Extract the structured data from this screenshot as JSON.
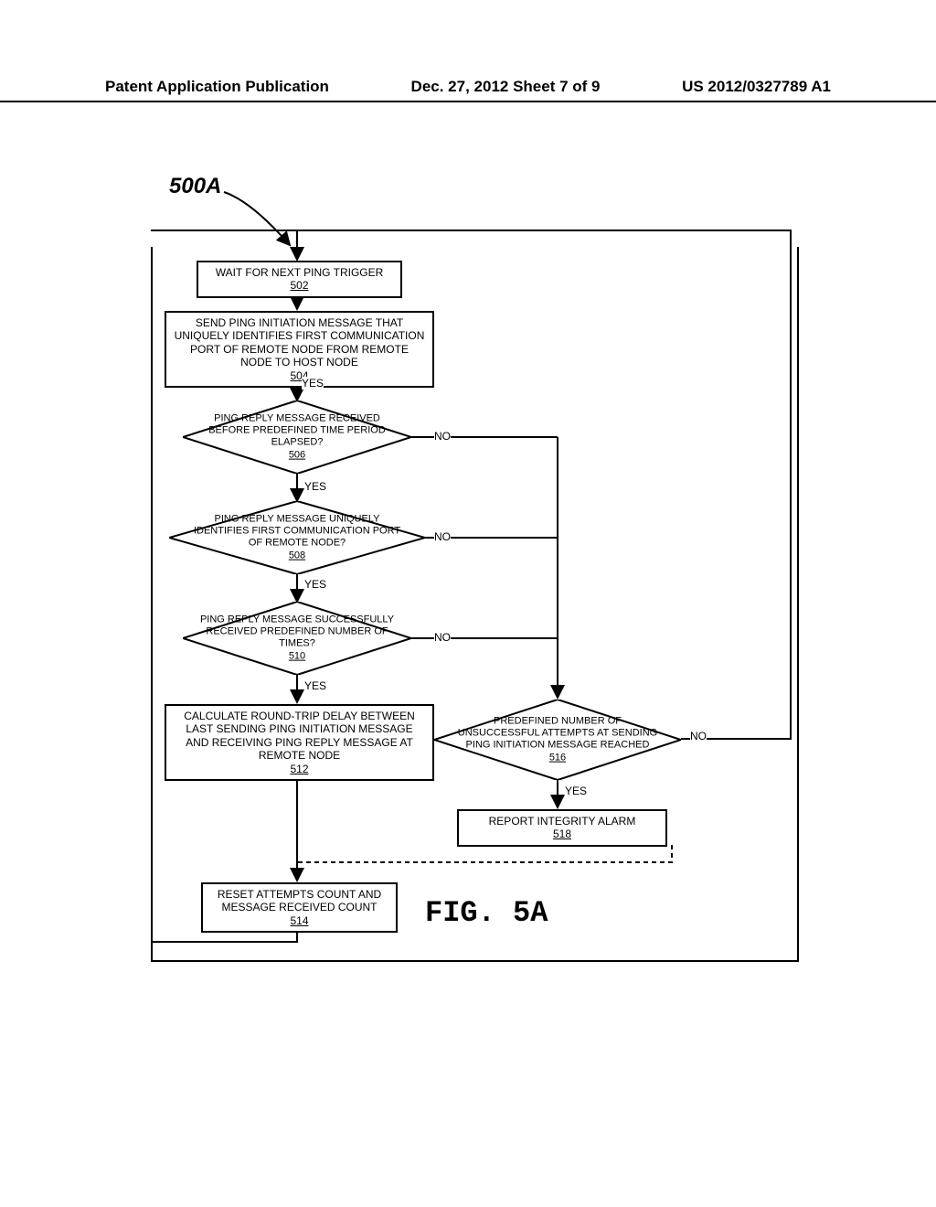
{
  "header": {
    "left": "Patent Application Publication",
    "center": "Dec. 27, 2012  Sheet 7 of 9",
    "right": "US 2012/0327789 A1"
  },
  "refLabel": "500A",
  "boxes": {
    "b502": {
      "text": "WAIT FOR NEXT PING TRIGGER",
      "ref": "502"
    },
    "b504": {
      "text": "SEND PING INITIATION MESSAGE THAT UNIQUELY IDENTIFIES FIRST COMMUNICATION PORT OF REMOTE NODE FROM REMOTE NODE TO HOST NODE",
      "ref": "504"
    },
    "b506": {
      "text": "PING REPLY MESSAGE RECEIVED BEFORE PREDEFINED TIME PERIOD ELAPSED?",
      "ref": "506"
    },
    "b508": {
      "text": "PING REPLY MESSAGE UNIQUELY IDENTIFIES FIRST COMMUNICATION PORT OF REMOTE NODE?",
      "ref": "508"
    },
    "b510": {
      "text": "PING REPLY MESSAGE SUCCESSFULLY RECEIVED PREDEFINED NUMBER OF TIMES?",
      "ref": "510"
    },
    "b512": {
      "text": "CALCULATE ROUND-TRIP DELAY BETWEEN LAST SENDING PING INITIATION MESSAGE AND RECEIVING PING REPLY MESSAGE AT REMOTE NODE",
      "ref": "512"
    },
    "b514": {
      "text": "RESET ATTEMPTS COUNT AND MESSAGE RECEIVED COUNT",
      "ref": "514"
    },
    "b516": {
      "text": "PREDEFINED NUMBER OF UNSUCCESSFUL ATTEMPTS AT SENDING PING INITIATION MESSAGE REACHED",
      "ref": "516"
    },
    "b518": {
      "text": "REPORT INTEGRITY ALARM",
      "ref": "518"
    }
  },
  "labels": {
    "yes": "YES",
    "no": "NO"
  },
  "figLabel": "FIG. 5A"
}
